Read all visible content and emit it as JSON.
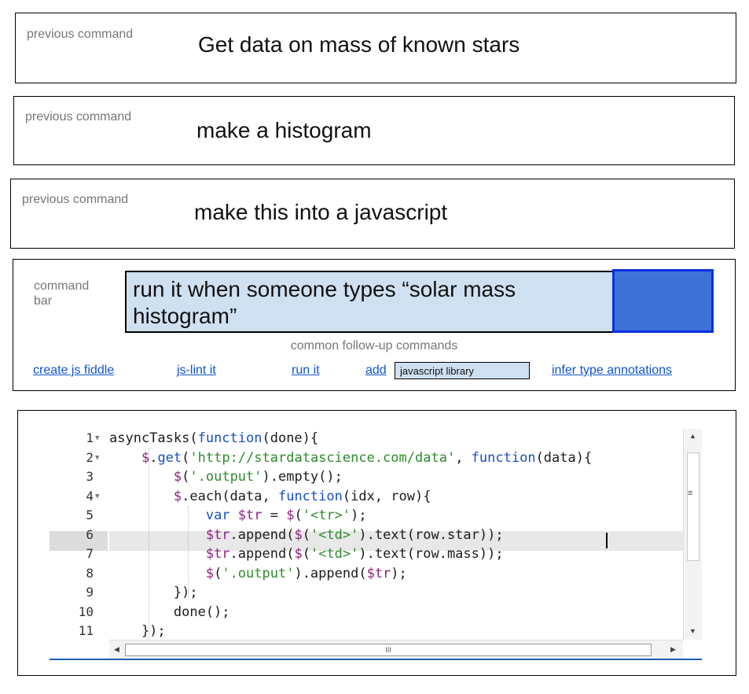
{
  "previous_commands": [
    {
      "label": "previous command",
      "text": "Get data on mass of known stars"
    },
    {
      "label": "previous command",
      "text": "make a histogram"
    },
    {
      "label": "previous command",
      "text": "make this into a javascript"
    }
  ],
  "command_bar": {
    "label": "command bar",
    "value": "run it when someone types “solar mass histogram”",
    "followup_title": "common follow-up commands",
    "followups": [
      "create js fiddle",
      "js-lint it",
      "run it",
      "add",
      "infer type annotations"
    ],
    "library_input_value": "javascript library"
  },
  "editor": {
    "line_numbers": [
      "1",
      "2",
      "3",
      "4",
      "5",
      "6",
      "7",
      "8",
      "9",
      "10",
      "11"
    ],
    "active_line": "6",
    "hscroll_thumb_glyph": "III",
    "colors": {
      "keyword": "#1a4fbf",
      "string": "#2e8b2e",
      "variable": "#8f2080",
      "active_line_bg": "#e8e8e8",
      "editor_bottom_border": "#1e5fb3"
    }
  },
  "colors": {
    "command_input_bg": "#cfe0f1",
    "submit_button_bg": "#3f72d8",
    "submit_button_border": "#0a2fe0",
    "link": "#1155cc",
    "label_gray": "#777777"
  }
}
